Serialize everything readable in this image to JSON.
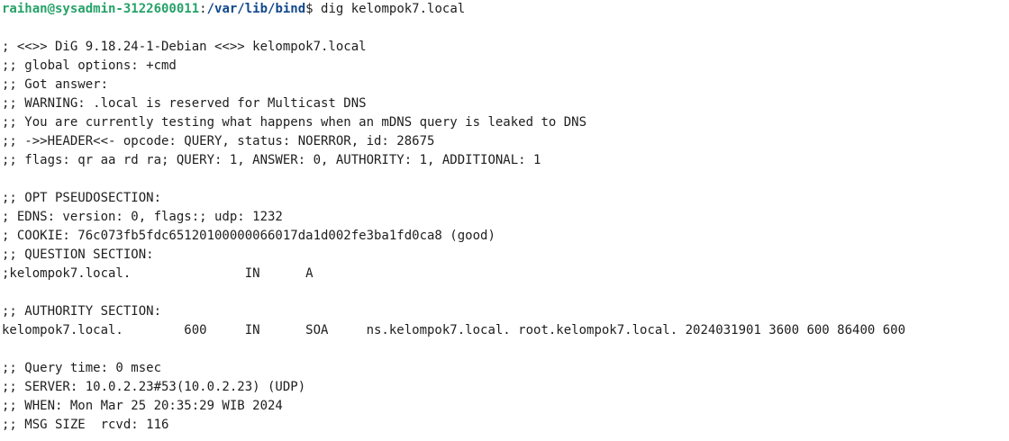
{
  "colors": {
    "background": "#ffffff",
    "text": "#1e1e1e",
    "prompt_user": "#26a269",
    "prompt_path": "#12488b"
  },
  "prompt": {
    "user_host": "raihan@sysadmin-3122600011",
    "separator": ":",
    "path": "/var/lib/bind",
    "symbol": "$",
    "command": " dig kelompok7.local"
  },
  "output": [
    "",
    "; <<>> DiG 9.18.24-1-Debian <<>> kelompok7.local",
    ";; global options: +cmd",
    ";; Got answer:",
    ";; WARNING: .local is reserved for Multicast DNS",
    ";; You are currently testing what happens when an mDNS query is leaked to DNS",
    ";; ->>HEADER<<- opcode: QUERY, status: NOERROR, id: 28675",
    ";; flags: qr aa rd ra; QUERY: 1, ANSWER: 0, AUTHORITY: 1, ADDITIONAL: 1",
    "",
    ";; OPT PSEUDOSECTION:",
    "; EDNS: version: 0, flags:; udp: 1232",
    "; COOKIE: 76c073fb5fdc65120100000066017da1d002fe3ba1fd0ca8 (good)",
    ";; QUESTION SECTION:",
    ";kelompok7.local.               IN      A",
    "",
    ";; AUTHORITY SECTION:",
    "kelompok7.local.        600     IN      SOA     ns.kelompok7.local. root.kelompok7.local. 2024031901 3600 600 86400 600",
    "",
    ";; Query time: 0 msec",
    ";; SERVER: 10.0.2.23#53(10.0.2.23) (UDP)",
    ";; WHEN: Mon Mar 25 20:35:29 WIB 2024",
    ";; MSG SIZE  rcvd: 116"
  ]
}
